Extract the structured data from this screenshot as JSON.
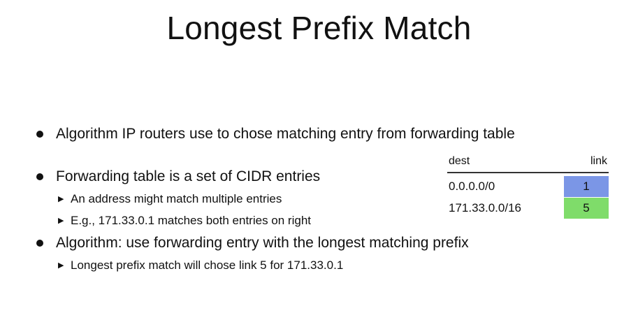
{
  "slide": {
    "title": "Longest Prefix Match",
    "bullets": [
      {
        "text": "Algorithm IP routers use to chose matching entry from forwarding table",
        "subs": []
      },
      {
        "text": "Forwarding table is a set of CIDR entries",
        "subs": [
          "An address might match multiple entries",
          "E.g., 171.33.0.1 matches both entries on right"
        ]
      },
      {
        "text": "Algorithm: use forwarding entry with the longest matching prefix",
        "subs": [
          "Longest prefix match will chose link 5 for 171.33.0.1"
        ]
      }
    ],
    "sub_marker": "▶"
  },
  "table": {
    "headers": {
      "dest": "dest",
      "link": "link"
    },
    "rows": [
      {
        "dest": "0.0.0.0/0",
        "link": "1",
        "color": "#7b96e6"
      },
      {
        "dest": "171.33.0.0/16",
        "link": "5",
        "color": "#7fdc6a"
      }
    ]
  }
}
